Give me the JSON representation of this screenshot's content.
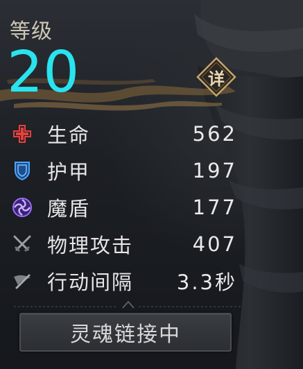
{
  "level": {
    "label": "等级",
    "value": "20"
  },
  "detail_button": {
    "label": "详"
  },
  "stats": [
    {
      "key": "hp",
      "label": "生命",
      "value": "562",
      "icon": "health-cross-icon",
      "color": "#e8403a"
    },
    {
      "key": "armor",
      "label": "护甲",
      "value": "197",
      "icon": "shield-icon",
      "color": "#4aa3ff"
    },
    {
      "key": "magic_shield",
      "label": "魔盾",
      "value": "177",
      "icon": "magic-shield-icon",
      "color": "#9b6cff"
    },
    {
      "key": "physical_attack",
      "label": "物理攻击",
      "value": "407",
      "icon": "crossed-swords-icon",
      "color": "#8a8f93"
    },
    {
      "key": "action_interval",
      "label": "行动间隔",
      "value": "3.3秒",
      "icon": "wing-blade-icon",
      "color": "#8a8f93"
    }
  ],
  "soul_link_button": {
    "label": "灵魂链接中"
  },
  "colors": {
    "level": "#29e3ef",
    "accent_gold": "#c9a36a"
  }
}
